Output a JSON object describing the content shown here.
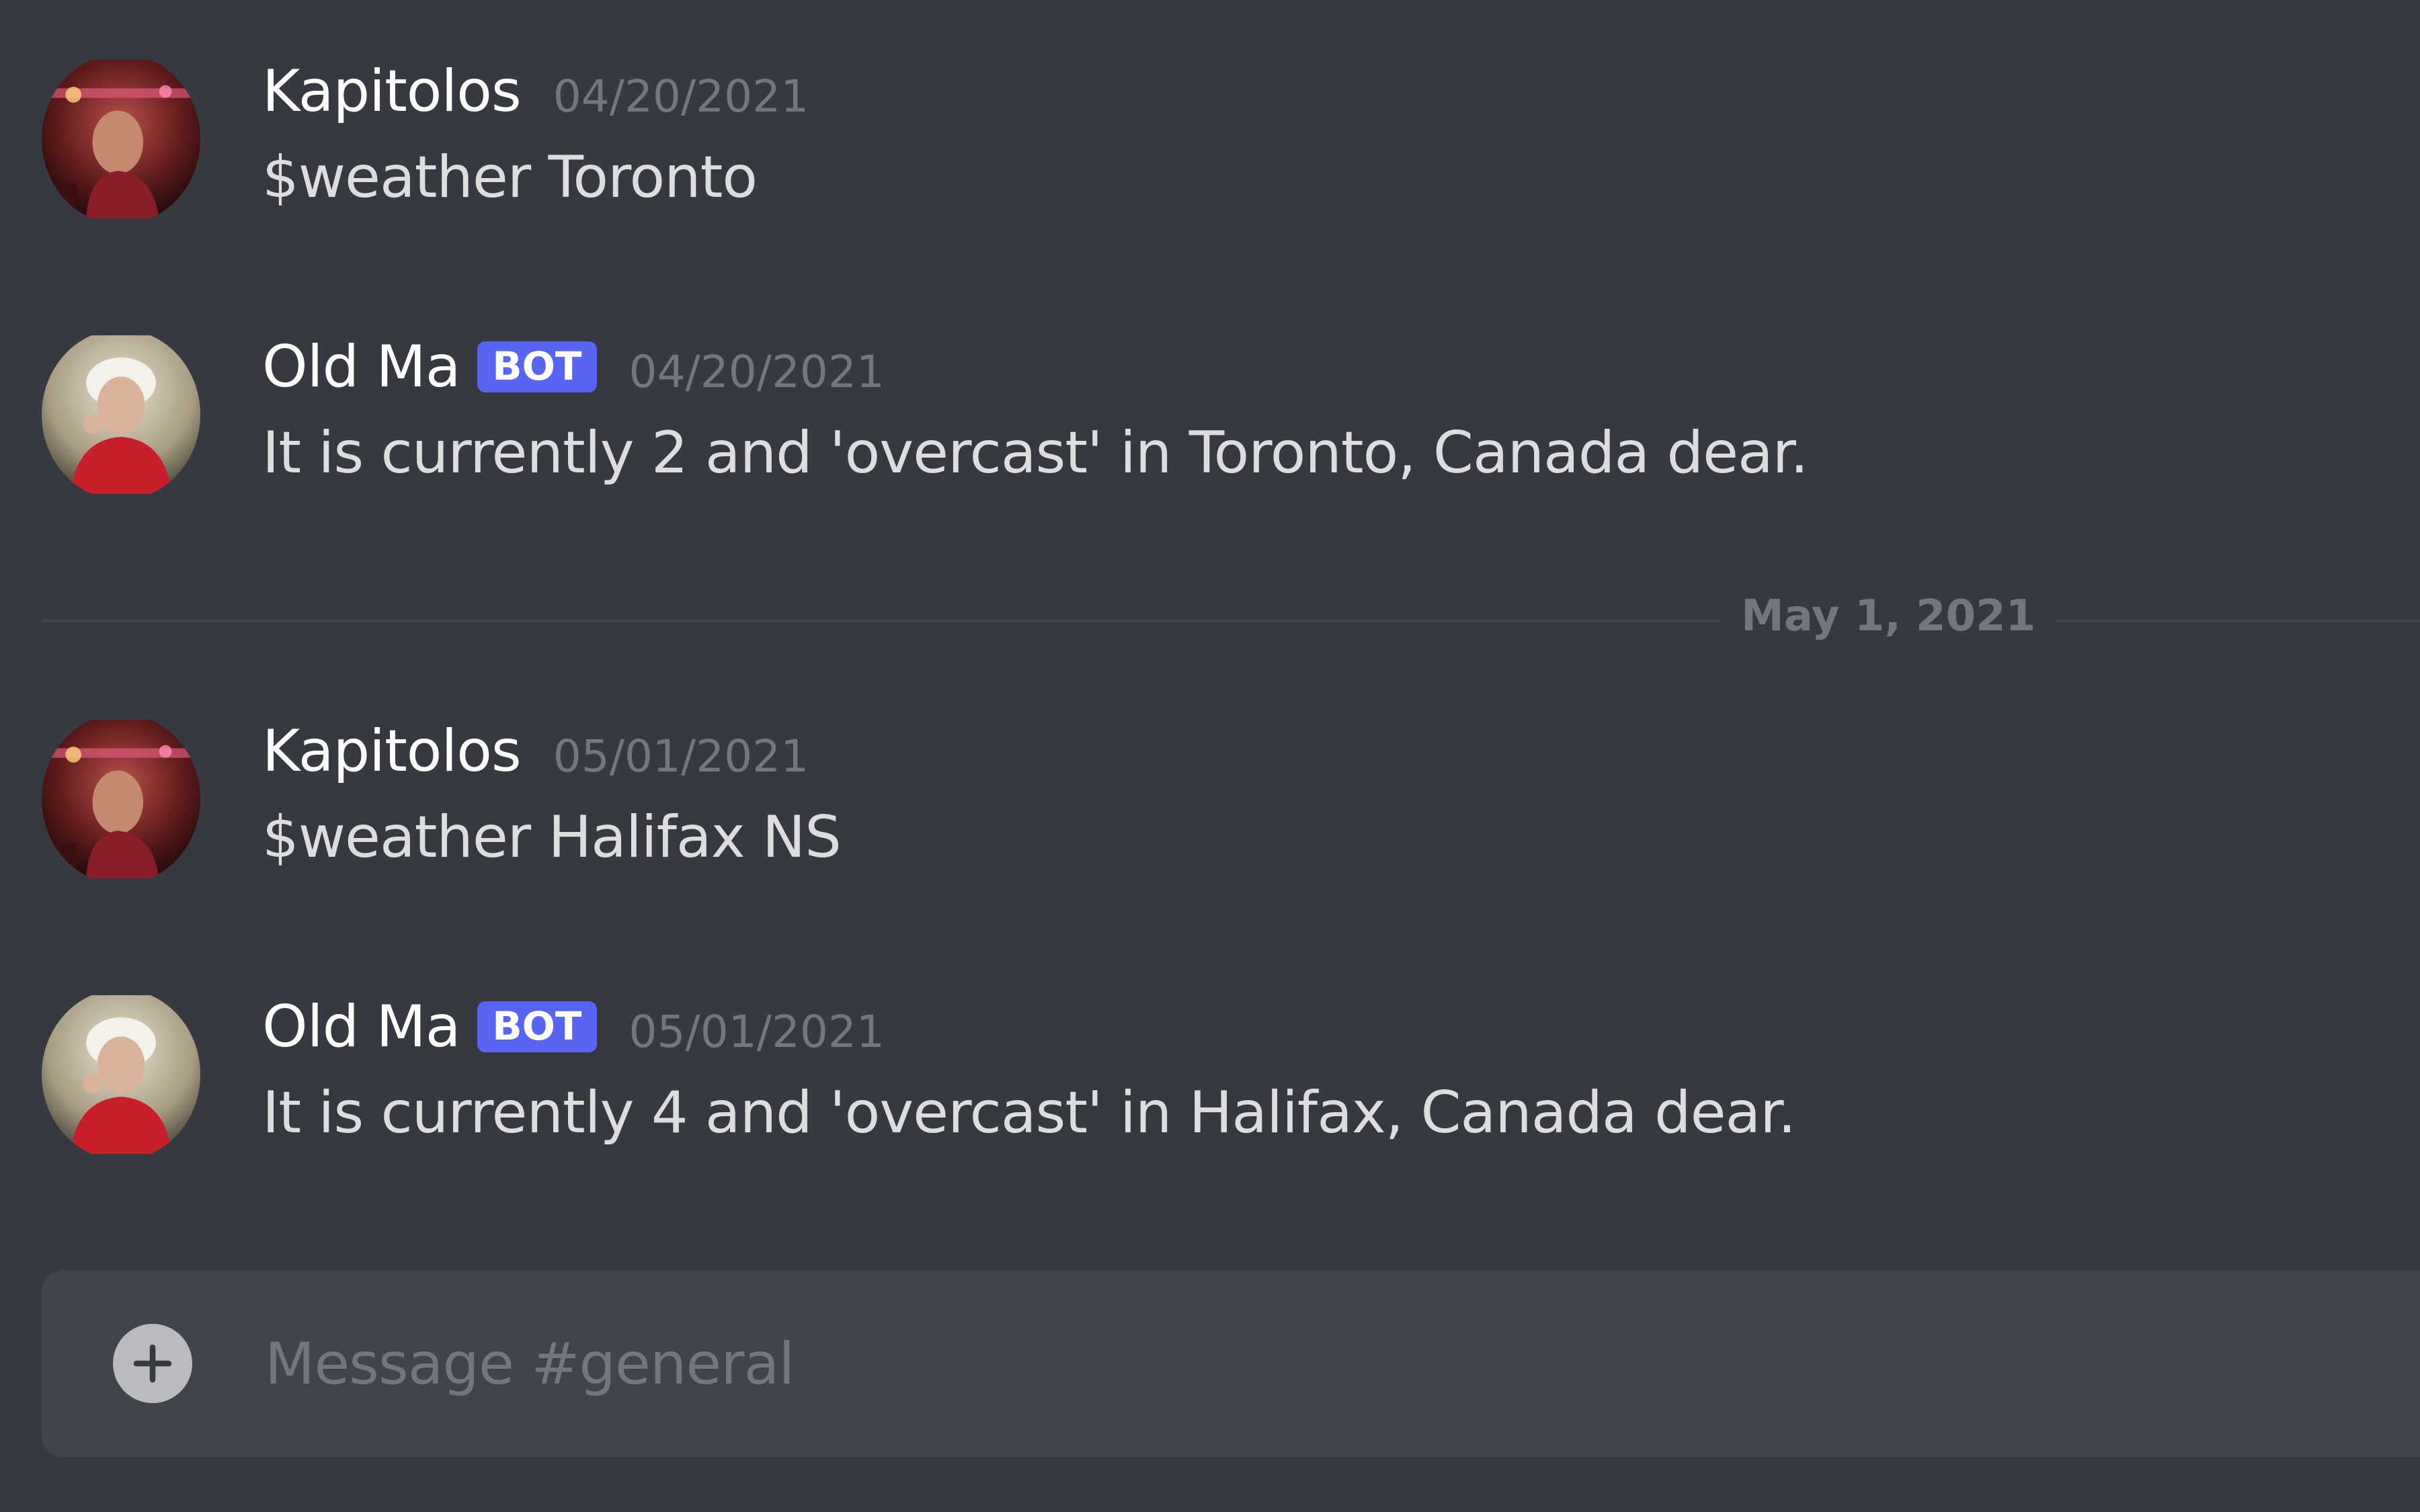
{
  "messages": [
    {
      "author": "Kapitolos",
      "timestamp": "04/20/2021",
      "content": "$weather Toronto",
      "avatar_icon": "user-photo-avatar-icon"
    },
    {
      "author": "Old Ma",
      "bot_tag": "BOT",
      "timestamp": "04/20/2021",
      "content": "It is currently 2 and 'overcast' in Toronto, Canada dear.",
      "avatar_icon": "bot-photo-avatar-icon"
    },
    {
      "author": "Kapitolos",
      "timestamp": "05/01/2021",
      "content": "$weather Halifax NS",
      "avatar_icon": "user-photo-avatar-icon"
    },
    {
      "author": "Old Ma",
      "bot_tag": "BOT",
      "timestamp": "05/01/2021",
      "content": "It is currently 4 and 'overcast' in Halifax, Canada dear.",
      "avatar_icon": "bot-photo-avatar-icon"
    }
  ],
  "date_divider": "May 1, 2021",
  "composer": {
    "placeholder": "Message #general",
    "add_icon": "plus-circle-icon"
  },
  "colors": {
    "background": "#36393f",
    "composer_background": "#40444b",
    "bot_tag": "#5865f2",
    "username": "#ffffff",
    "message_text": "#dcddde",
    "muted_text": "#72767d"
  }
}
